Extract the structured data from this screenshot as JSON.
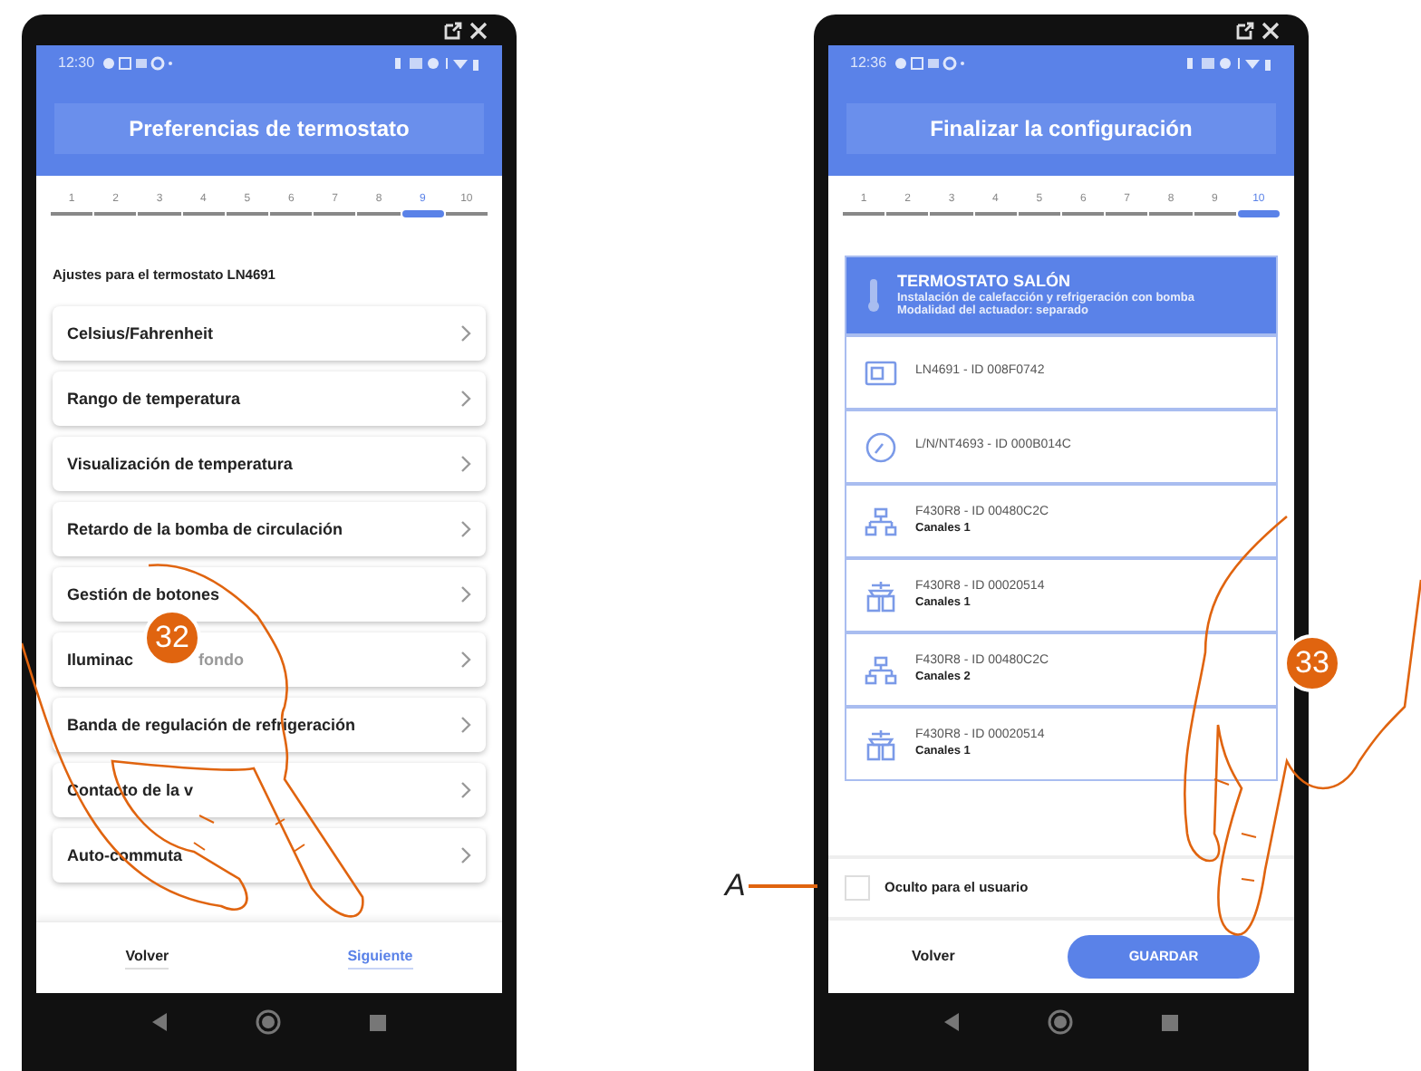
{
  "phones": [
    {
      "kind": "settings",
      "status_time": "12:30",
      "title": "Preferencias de termostato",
      "steps": [
        {
          "label": "1",
          "selected": false
        },
        {
          "label": "2",
          "selected": false
        },
        {
          "label": "3",
          "selected": false
        },
        {
          "label": "4",
          "selected": false
        },
        {
          "label": "5",
          "selected": false
        },
        {
          "label": "6",
          "selected": false
        },
        {
          "label": "7",
          "selected": false
        },
        {
          "label": "8",
          "selected": false
        },
        {
          "label": "9",
          "selected": true
        },
        {
          "label": "10",
          "selected": false
        }
      ],
      "subtitle": "Ajustes para el termostato LN4691",
      "items": [
        {
          "label": "Celsius/Fahrenheit"
        },
        {
          "label": "Rango de temperatura"
        },
        {
          "label": "Visualización de temperatura"
        },
        {
          "label": "Retardo de la bomba de circulación"
        },
        {
          "label": "Gestión de botones"
        },
        {
          "label": "Iluminac",
          "label_after_callout": "fondo"
        },
        {
          "label": "Banda de regulación de refrigeración"
        },
        {
          "label": "Contacto de la v"
        },
        {
          "label": "Auto-commuta"
        }
      ],
      "back": "Volver",
      "next": "Siguiente"
    },
    {
      "kind": "summary",
      "status_time": "12:36",
      "title": "Finalizar la configuración",
      "steps": [
        {
          "label": "1",
          "selected": false
        },
        {
          "label": "2",
          "selected": false
        },
        {
          "label": "3",
          "selected": false
        },
        {
          "label": "4",
          "selected": false
        },
        {
          "label": "5",
          "selected": false
        },
        {
          "label": "6",
          "selected": false
        },
        {
          "label": "7",
          "selected": false
        },
        {
          "label": "8",
          "selected": false
        },
        {
          "label": "9",
          "selected": false
        },
        {
          "label": "10",
          "selected": true
        }
      ],
      "summary": {
        "title": "TERMOSTATO SALÓN",
        "lines": [
          "Instalación de calefacción y refrigeración con bomba",
          "Modalidad del actuador: separado"
        ]
      },
      "devices": [
        {
          "kind": "thermostat",
          "name": "LN4691 - ID 008F0742"
        },
        {
          "kind": "probe",
          "name": "L/N/NT4693 - ID 000B014C"
        },
        {
          "kind": "network",
          "name": "F430R8 - ID 00480C2C",
          "detail": "Canales 1"
        },
        {
          "kind": "pump",
          "name": "F430R8 - ID 00020514",
          "detail": "Canales 1"
        },
        {
          "kind": "network",
          "name": "F430R8 - ID 00480C2C",
          "detail": "Canales 2"
        },
        {
          "kind": "pump",
          "name": "F430R8 - ID 00020514",
          "detail": "Canales 1"
        }
      ],
      "hidden_option": {
        "label": "Oculto para el usuario",
        "checked": false
      },
      "back": "Volver",
      "save": "GUARDAR"
    }
  ],
  "callouts": [
    "32",
    "33"
  ],
  "annotation": "A"
}
